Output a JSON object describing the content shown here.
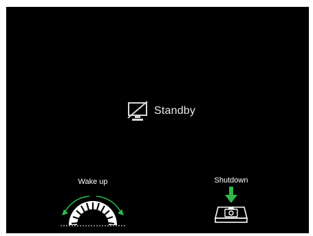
{
  "screen": {
    "background": "#000000",
    "standby": {
      "icon": "monitor-off-icon",
      "label": "Standby"
    },
    "wake_up": {
      "icon": "rotate-dial-icon",
      "label": "Wake up",
      "arrow_color": "#2fb84a"
    },
    "shutdown": {
      "icon": "press-button-icon",
      "label": "Shutdown",
      "arrow_color": "#2fb84a"
    }
  }
}
